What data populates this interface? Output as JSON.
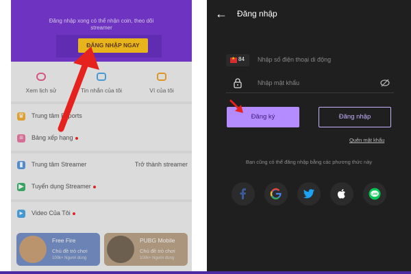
{
  "left_phone": {
    "header_hint": "Đăng nhập xong có thể nhận coin, theo dõi streamer",
    "login_now_button": "ĐĂNG NHẬP NGAY",
    "quick_items": [
      {
        "label": "Xem lịch sử",
        "icon": "history-icon"
      },
      {
        "label": "Tin nhắn của tôi",
        "icon": "message-icon"
      },
      {
        "label": "Ví của tôi",
        "icon": "wallet-icon"
      }
    ],
    "menu": [
      {
        "label": "Trung tâm Esports",
        "icon": "trophy-icon"
      },
      {
        "label": "Bảng xếp hạng",
        "icon": "ranking-icon",
        "dot": true
      },
      {
        "label": "Trung tâm Streamer",
        "right": "Trở thành streamer",
        "icon": "streamer-center-icon"
      },
      {
        "label": "Tuyển dụng Streamer",
        "icon": "recruit-icon",
        "dot": true
      },
      {
        "label": "Video Của Tôi",
        "icon": "video-icon",
        "dot": true
      }
    ],
    "game_cards": [
      {
        "title": "Free Fire",
        "subtitle": "Chủ đề trò chơi",
        "users": "100k+ Người dùng"
      },
      {
        "title": "PUBG Mobile",
        "subtitle": "Chủ đề trò chơi",
        "users": "100k+ Người dùng"
      }
    ]
  },
  "right_phone": {
    "title": "Đăng nhập",
    "country_code": "84",
    "phone_placeholder": "Nhập số điện thoại di động",
    "password_placeholder": "Nhập mật khẩu",
    "signup_button": "Đăng ký",
    "login_button": "Đăng nhập",
    "forgot_password": "Quên mật khẩu",
    "alt_login_text": "Bạn cũng có thể đăng nhập bằng các phương thức này",
    "social": [
      {
        "name": "facebook-icon",
        "color": "#3b5998"
      },
      {
        "name": "google-icon",
        "color": "#4285f4"
      },
      {
        "name": "twitter-icon",
        "color": "#1da1f2"
      },
      {
        "name": "apple-icon",
        "color": "#ffffff"
      },
      {
        "name": "line-icon",
        "color": "#06c755"
      }
    ]
  },
  "colors": {
    "brand_purple": "#6d24d2",
    "login_now_yellow": "#ffc107",
    "signup_purple": "#b58cff",
    "arrow_red": "#e5221d"
  }
}
